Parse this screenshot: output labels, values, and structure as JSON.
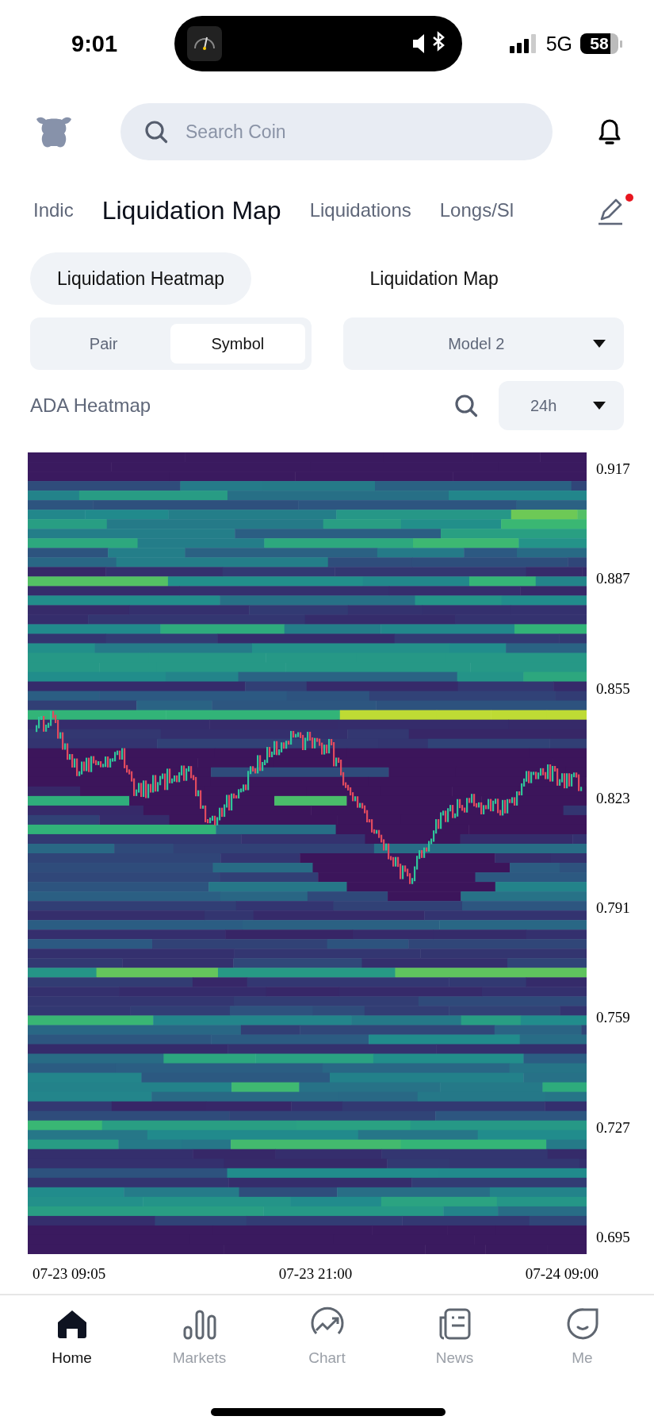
{
  "status_bar": {
    "time": "9:01",
    "network": "5G",
    "battery": "58"
  },
  "search": {
    "placeholder": "Search Coin"
  },
  "tabs": [
    {
      "label": "Indic",
      "selected": false
    },
    {
      "label": "Liquidation Map",
      "selected": true
    },
    {
      "label": "Liquidations",
      "selected": false
    },
    {
      "label": "Longs/Sl",
      "selected": false
    }
  ],
  "edit_badge": true,
  "sub_tabs": [
    {
      "label": "Liquidation Heatmap",
      "selected": true
    },
    {
      "label": "Liquidation Map",
      "selected": false
    }
  ],
  "segments": [
    {
      "label": "Pair",
      "selected": false
    },
    {
      "label": "Symbol",
      "selected": true
    }
  ],
  "model_dropdown": {
    "value": "Model 2"
  },
  "heatmap": {
    "title": "ADA Heatmap",
    "range": {
      "value": "24h"
    },
    "y_ticks": [
      "0.917",
      "0.887",
      "0.855",
      "0.823",
      "0.791",
      "0.759",
      "0.727",
      "0.695"
    ],
    "x_ticks": [
      "07-23 09:05",
      "07-23 21:00",
      "07-24 09:00"
    ]
  },
  "nav": [
    {
      "label": "Home",
      "selected": true
    },
    {
      "label": "Markets",
      "selected": false
    },
    {
      "label": "Chart",
      "selected": false
    },
    {
      "label": "News",
      "selected": false
    },
    {
      "label": "Me",
      "selected": false
    }
  ]
}
